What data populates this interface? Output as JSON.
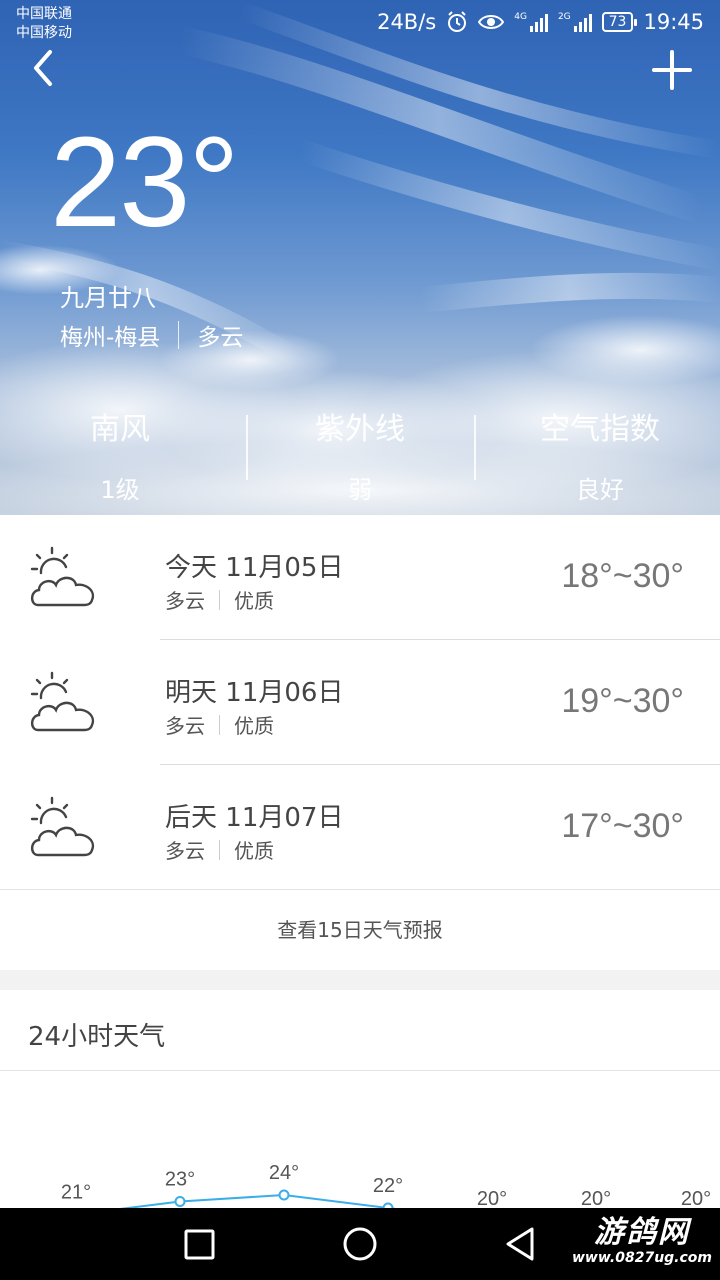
{
  "status_bar": {
    "carrier1": "中国联通",
    "carrier2": "中国移动",
    "net_speed": "24B/s",
    "net1": "4G",
    "net2": "2G",
    "battery": "73",
    "time": "19:45"
  },
  "current": {
    "temperature": "23°",
    "lunar_date": "九月廿八",
    "location": "梅州-梅县",
    "condition": "多云"
  },
  "indices": [
    {
      "title": "南风",
      "value": "1级"
    },
    {
      "title": "紫外线",
      "value": "弱"
    },
    {
      "title": "空气指数",
      "value": "良好"
    }
  ],
  "forecast": [
    {
      "day": "今天",
      "date": "11月05日",
      "condition": "多云",
      "air": "优质",
      "range": "18°~30°",
      "icon": "partly-cloudy-icon"
    },
    {
      "day": "明天",
      "date": "11月06日",
      "condition": "多云",
      "air": "优质",
      "range": "19°~30°",
      "icon": "partly-cloudy-icon"
    },
    {
      "day": "后天",
      "date": "11月07日",
      "condition": "多云",
      "air": "优质",
      "range": "17°~30°",
      "icon": "partly-cloudy-icon"
    }
  ],
  "more_link": "查看15日天气预报",
  "hourly": {
    "title": "24小时天气",
    "temps": [
      21,
      23,
      24,
      22,
      20,
      20,
      20
    ],
    "labels": [
      "21°",
      "23°",
      "24°",
      "22°",
      "20°",
      "20°",
      "20°"
    ],
    "line_color": "#3aaee8"
  },
  "watermark": {
    "line1": "游鸽网",
    "line2": "www.0827ug.com"
  }
}
